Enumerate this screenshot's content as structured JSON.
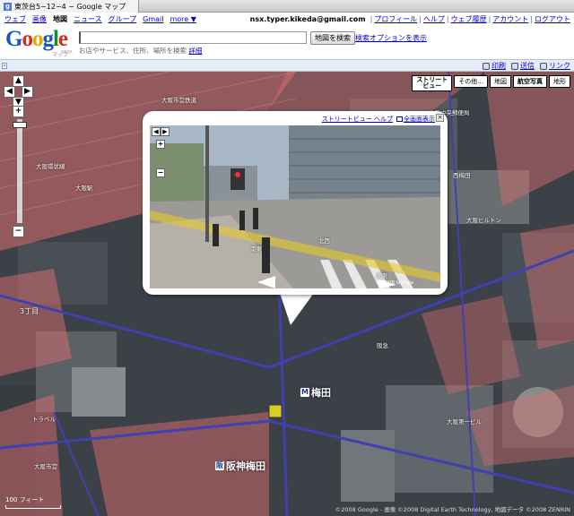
{
  "browser": {
    "tab_title": "東茨台5−12−4 − Google マップ"
  },
  "topnav": {
    "items": [
      "ウェブ",
      "画像",
      "地図",
      "ニュース",
      "グループ",
      "Gmail"
    ],
    "active": "地図",
    "more": "more ▼"
  },
  "account": {
    "email": "nsx.typer.kikeda@gmail.com",
    "links": [
      "プロフィール",
      "ヘルプ",
      "ウェブ履歴",
      "アカウント",
      "ログアウト"
    ]
  },
  "header": {
    "logo": {
      "G": "G",
      "o1": "o",
      "o2": "o",
      "g": "g",
      "l": "l",
      "e": "e",
      "sub": "マップ",
      "beta": "BETA"
    },
    "search": {
      "value": "",
      "hint": "お店やサービス、住所、場所を検索",
      "hint_link": "詳細"
    },
    "search_button": "地図を検索",
    "search_options": "検索オプションを表示"
  },
  "toolbar": {
    "print": "印刷",
    "send": "送信",
    "link": "リンク",
    "collapse": "«"
  },
  "map": {
    "types": [
      {
        "label_line1": "ストリート",
        "label_line2": "ビュー"
      },
      {
        "label": "その他..."
      },
      {
        "label": "地図"
      },
      {
        "label": "航空写真",
        "selected": true
      },
      {
        "label": "地形"
      }
    ],
    "labels": {
      "l1": "大阪市営鉄道",
      "l2": "大阪環状線",
      "l3": "大阪駅",
      "l4": "大阪中央郵便局",
      "l5": "西梅田",
      "l6": "大阪ヒルトン",
      "l7": "大阪第一ビル",
      "l8": "トラベル",
      "l9": "大阪市営",
      "l10": "阪急"
    },
    "chome": "3丁目",
    "stations": {
      "umeda": "梅田",
      "hanshin": "阪神梅田"
    },
    "scale": "100 フィート",
    "copyright": "©2008 Google - 画像 ©2008 Digital Earth Technology, 地図データ ©2008 ZENRIN"
  },
  "streetview": {
    "help_link": "ストリートビュー ヘルプ",
    "fullscreen_link": "全画面表示",
    "labels": {
      "s1": "南東",
      "s2": "北東",
      "s3": "北西"
    },
    "copyright": "© 2008 Google"
  }
}
